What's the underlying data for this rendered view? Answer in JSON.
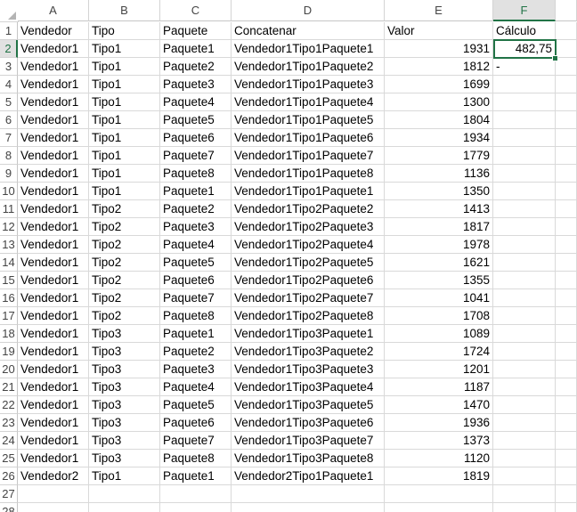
{
  "columns": [
    {
      "letter": "A",
      "name": "col-a"
    },
    {
      "letter": "B",
      "name": "col-b"
    },
    {
      "letter": "C",
      "name": "col-c"
    },
    {
      "letter": "D",
      "name": "col-d"
    },
    {
      "letter": "E",
      "name": "col-e"
    },
    {
      "letter": "F",
      "name": "col-f"
    }
  ],
  "selected_column": "F",
  "selected_row": 2,
  "row_numbers": [
    "1",
    "2",
    "3",
    "4",
    "5",
    "6",
    "7",
    "8",
    "9",
    "10",
    "11",
    "12",
    "13",
    "14",
    "15",
    "16",
    "17",
    "18",
    "19",
    "20",
    "21",
    "22",
    "23",
    "24",
    "25",
    "26",
    "27",
    "28"
  ],
  "rows": [
    [
      "Vendedor",
      "Tipo",
      "Paquete",
      "Concatenar",
      "Valor",
      "Cálculo"
    ],
    [
      "Vendedor1",
      "Tipo1",
      "Paquete1",
      "Vendedor1Tipo1Paquete1",
      "1931",
      "482,75"
    ],
    [
      "Vendedor1",
      "Tipo1",
      "Paquete2",
      "Vendedor1Tipo1Paquete2",
      "1812",
      "-"
    ],
    [
      "Vendedor1",
      "Tipo1",
      "Paquete3",
      "Vendedor1Tipo1Paquete3",
      "1699",
      ""
    ],
    [
      "Vendedor1",
      "Tipo1",
      "Paquete4",
      "Vendedor1Tipo1Paquete4",
      "1300",
      ""
    ],
    [
      "Vendedor1",
      "Tipo1",
      "Paquete5",
      "Vendedor1Tipo1Paquete5",
      "1804",
      ""
    ],
    [
      "Vendedor1",
      "Tipo1",
      "Paquete6",
      "Vendedor1Tipo1Paquete6",
      "1934",
      ""
    ],
    [
      "Vendedor1",
      "Tipo1",
      "Paquete7",
      "Vendedor1Tipo1Paquete7",
      "1779",
      ""
    ],
    [
      "Vendedor1",
      "Tipo1",
      "Paquete8",
      "Vendedor1Tipo1Paquete8",
      "1136",
      ""
    ],
    [
      "Vendedor1",
      "Tipo1",
      "Paquete1",
      "Vendedor1Tipo1Paquete1",
      "1350",
      ""
    ],
    [
      "Vendedor1",
      "Tipo2",
      "Paquete2",
      "Vendedor1Tipo2Paquete2",
      "1413",
      ""
    ],
    [
      "Vendedor1",
      "Tipo2",
      "Paquete3",
      "Vendedor1Tipo2Paquete3",
      "1817",
      ""
    ],
    [
      "Vendedor1",
      "Tipo2",
      "Paquete4",
      "Vendedor1Tipo2Paquete4",
      "1978",
      ""
    ],
    [
      "Vendedor1",
      "Tipo2",
      "Paquete5",
      "Vendedor1Tipo2Paquete5",
      "1621",
      ""
    ],
    [
      "Vendedor1",
      "Tipo2",
      "Paquete6",
      "Vendedor1Tipo2Paquete6",
      "1355",
      ""
    ],
    [
      "Vendedor1",
      "Tipo2",
      "Paquete7",
      "Vendedor1Tipo2Paquete7",
      "1041",
      ""
    ],
    [
      "Vendedor1",
      "Tipo2",
      "Paquete8",
      "Vendedor1Tipo2Paquete8",
      "1708",
      ""
    ],
    [
      "Vendedor1",
      "Tipo3",
      "Paquete1",
      "Vendedor1Tipo3Paquete1",
      "1089",
      ""
    ],
    [
      "Vendedor1",
      "Tipo3",
      "Paquete2",
      "Vendedor1Tipo3Paquete2",
      "1724",
      ""
    ],
    [
      "Vendedor1",
      "Tipo3",
      "Paquete3",
      "Vendedor1Tipo3Paquete3",
      "1201",
      ""
    ],
    [
      "Vendedor1",
      "Tipo3",
      "Paquete4",
      "Vendedor1Tipo3Paquete4",
      "1187",
      ""
    ],
    [
      "Vendedor1",
      "Tipo3",
      "Paquete5",
      "Vendedor1Tipo3Paquete5",
      "1470",
      ""
    ],
    [
      "Vendedor1",
      "Tipo3",
      "Paquete6",
      "Vendedor1Tipo3Paquete6",
      "1936",
      ""
    ],
    [
      "Vendedor1",
      "Tipo3",
      "Paquete7",
      "Vendedor1Tipo3Paquete7",
      "1373",
      ""
    ],
    [
      "Vendedor1",
      "Tipo3",
      "Paquete8",
      "Vendedor1Tipo3Paquete8",
      "1120",
      ""
    ],
    [
      "Vendedor2",
      "Tipo1",
      "Paquete1",
      "Vendedor2Tipo1Paquete1",
      "1819",
      ""
    ],
    [
      "",
      "",
      "",
      "",
      "",
      ""
    ],
    [
      "",
      "",
      "",
      "",
      "",
      ""
    ]
  ],
  "colors": {
    "selection_accent": "#217346",
    "gridline": "#d9d9d9",
    "header_selected_bg": "#e1e1e1"
  },
  "icons": {
    "select_all": "select-all-triangle-icon"
  }
}
